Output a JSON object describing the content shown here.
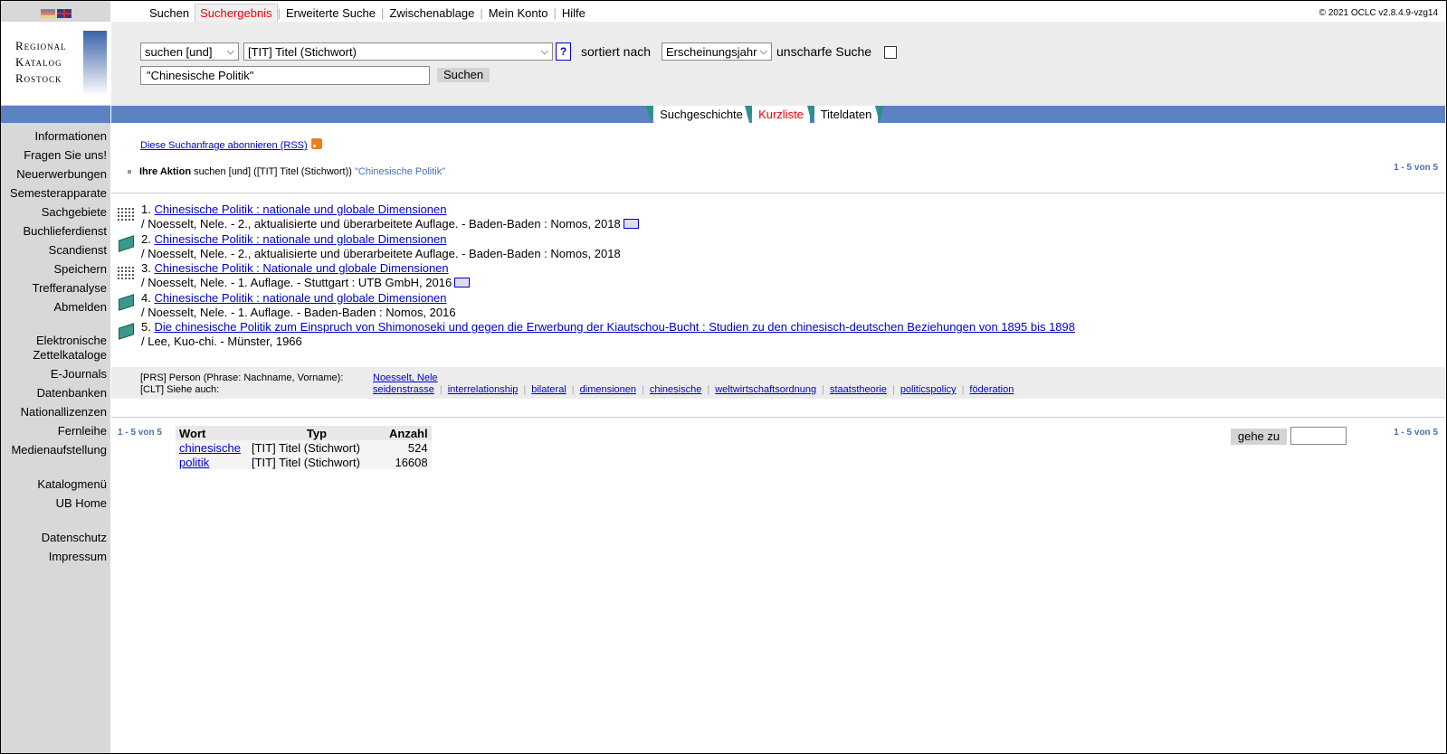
{
  "topnav": {
    "tabs": [
      "Suchen",
      "Suchergebnis",
      "Erweiterte Suche",
      "Zwischenablage",
      "Mein Konto",
      "Hilfe"
    ],
    "copyright": "© 2021 OCLC v2.8.4.9-vzg14"
  },
  "logo": {
    "line1": "Regional",
    "line2": "Katalog",
    "line3": "Rostock"
  },
  "leftnav": {
    "items": [
      "Informationen",
      "Fragen Sie uns!",
      "Neuerwerbungen",
      "Semesterapparate",
      "Sachgebiete",
      "Buchlieferdienst",
      "Scandienst",
      "Speichern",
      "Trefferanalyse",
      "Abmelden"
    ],
    "group2": [
      "Elektronische Zettelkataloge",
      "E-Journals",
      "Datenbanken",
      "Nationallizenzen",
      "Fernleihe",
      "Medienaufstellung"
    ],
    "group3": [
      "Katalogmenü",
      "UB Home"
    ],
    "group4": [
      "Datenschutz",
      "Impressum"
    ]
  },
  "search": {
    "operator": "suchen [und]",
    "field": "[TIT] Titel (Stichwort)",
    "help": "?",
    "sorted_label": "sortiert nach",
    "sort": "Erscheinungsjahr",
    "fuzzy_label": "unscharfe Suche",
    "query": "\"Chinesische Politik\"",
    "button": "Suchen"
  },
  "viewtabs": [
    "Suchgeschichte",
    "Kurzliste",
    "Titeldaten"
  ],
  "rss": "Diese Suchanfrage abonnieren (RSS)",
  "action": {
    "label": "Ihre Aktion",
    "text": "suchen [und] ([TIT] Titel (Stichwort))",
    "query": "\"Chinesische Politik\""
  },
  "count": "1 - 5 von 5",
  "results": [
    {
      "num": "1.",
      "icon": "dots-icon",
      "title": "Chinesische Politik : nationale und globale Dimensionen",
      "sub": "/ Noesselt, Nele. - 2., aktualisierte und überarbeitete Auflage. - Baden-Baden : Nomos, 2018",
      "tag": true
    },
    {
      "num": "2.",
      "icon": "book-icon",
      "title": "Chinesische Politik : nationale und globale Dimensionen",
      "sub": "/ Noesselt, Nele. - 2., aktualisierte und überarbeitete Auflage. - Baden-Baden : Nomos, 2018",
      "tag": false
    },
    {
      "num": "3.",
      "icon": "dots-icon",
      "title": "Chinesische Politik : Nationale und globale Dimensionen",
      "sub": "/ Noesselt, Nele. - 1. Auflage. - Stuttgart : UTB GmbH, 2016",
      "tag": true
    },
    {
      "num": "4.",
      "icon": "book-icon",
      "title": "Chinesische Politik : nationale und globale Dimensionen",
      "sub": "/ Noesselt, Nele. - 1. Auflage. - Baden-Baden : Nomos, 2016",
      "tag": false
    },
    {
      "num": "5.",
      "icon": "book-icon",
      "title": "Die chinesische Politik zum Einspruch von Shimonoseki und gegen die Erwerbung der Kiautschou-Bucht : Studien zu den chinesisch-deutschen Beziehungen von 1895 bis 1898",
      "sub": "/ Lee, Kuo-chi. - Münster, 1966",
      "tag": false
    }
  ],
  "refine": {
    "prs_label": "[PRS] Person (Phrase: Nachname, Vorname):",
    "prs_value": "Noesselt, Nele",
    "clt_label": "[CLT] Siehe auch:",
    "links": [
      "seidenstrasse",
      "interrelationship",
      "bilateral",
      "dimensionen",
      "chinesische",
      "weltwirtschaftsordnung",
      "staatstheorie",
      "politicspolicy",
      "föderation"
    ]
  },
  "wordtable": {
    "headers": [
      "Wort",
      "Typ",
      "Anzahl"
    ],
    "rows": [
      {
        "word": "chinesische",
        "type": "[TIT] Titel (Stichwort)",
        "count": "524"
      },
      {
        "word": "politik",
        "type": "[TIT] Titel (Stichwort)",
        "count": "16608"
      }
    ]
  },
  "goto": {
    "label": "gehe zu",
    "value": ""
  }
}
